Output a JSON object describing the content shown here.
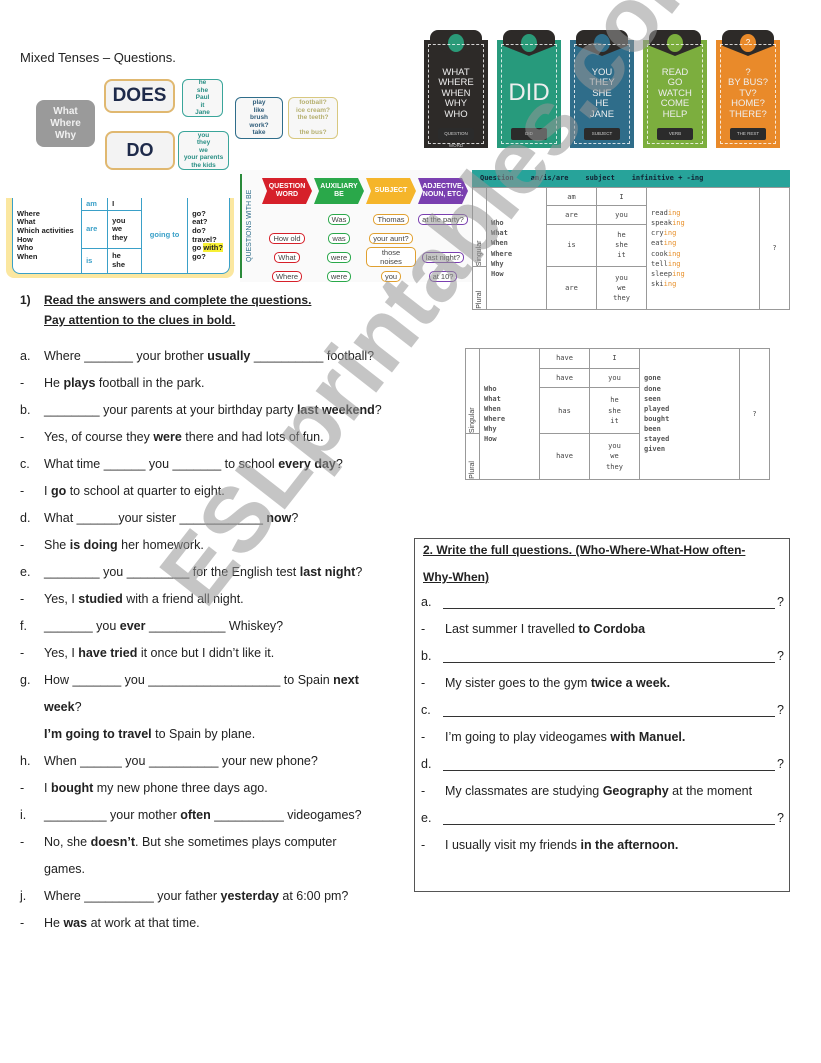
{
  "title": "Mixed Tenses – Questions.",
  "diagram_do": {
    "qwords": "What\nWhere\nWhy",
    "does": "DOES",
    "does_subjects": [
      "he",
      "she",
      "Paul",
      "it",
      "Jane"
    ],
    "do": "DO",
    "do_subjects": [
      "you",
      "they",
      "we",
      "your parents",
      "the kids"
    ],
    "verbs": [
      "play",
      "like",
      "brush",
      "work?",
      "take"
    ],
    "objects": [
      "football?",
      "ice cream?",
      "the teeth?",
      "",
      "the bus?"
    ]
  },
  "cards": [
    {
      "lines": [
        "WHAT",
        "WHERE",
        "WHEN",
        "WHY",
        "WHO"
      ],
      "label": "QUESTION WORD",
      "icon": "puzzle-icon",
      "color": "#2d2a28",
      "dot": "#2a9a78"
    },
    {
      "lines": [
        "DID"
      ],
      "label": "DID",
      "icon": "circle-icon",
      "color": "#279a7c",
      "dot": "#2a9a78"
    },
    {
      "lines": [
        "YOU",
        "THEY",
        "SHE",
        "HE",
        "JANE"
      ],
      "label": "SUBJECT",
      "icon": "person-icon",
      "color": "#2f6d8a",
      "dot": "#2f6d8a"
    },
    {
      "lines": [
        "READ",
        "GO",
        "WATCH",
        "COME",
        "HELP"
      ],
      "label": "VERB",
      "icon": "rocket-icon",
      "color": "#7cae3e",
      "dot": "#7cae3e"
    },
    {
      "lines": [
        "?",
        "BY BUS?",
        "TV?",
        "HOME?",
        "THERE?"
      ],
      "label": "THE REST",
      "icon": "question-icon",
      "color": "#e98a2a",
      "dot": "#e98a2a"
    }
  ],
  "going_to": {
    "qwords": [
      "Where",
      "What",
      "Which activities",
      "How",
      "Who",
      "When"
    ],
    "be": [
      "am",
      "are",
      "is"
    ],
    "subjects": [
      "I",
      "you\nwe\nthey",
      "he\nshe"
    ],
    "middle": "going to",
    "verbs_before": [
      "go?",
      "eat?",
      "do?",
      "travel?",
      "go "
    ],
    "highlight": "with?",
    "verb_last": "go?"
  },
  "be_questions": {
    "side": "QUESTIONS WITH BE",
    "headers": [
      "QUESTION\nWORD",
      "AUXILIARY\nBE",
      "SUBJECT",
      "ADJECTIVE,\nNOUN, ETC."
    ],
    "header_colors": [
      "#d6202a",
      "#2aa84a",
      "#f5b52a",
      "#7a3fb0"
    ],
    "rows": [
      [
        "",
        "Was",
        "Thomas",
        "at the party?"
      ],
      [
        "How old",
        "was",
        "your aunt?",
        ""
      ],
      [
        "What",
        "were",
        "those noises",
        "last night?"
      ],
      [
        "Where",
        "were",
        "you",
        "at 10?"
      ]
    ]
  },
  "present_continuous": {
    "header": "Question    am/is/are    subject    infinitive + -ing",
    "singular": "Singular",
    "plural": "Plural",
    "qwords": "Who\nWhat\nWhen\nWhere\nWhy\nHow",
    "aux": [
      "am",
      "are",
      "is",
      "are"
    ],
    "subjects": [
      "I",
      "you",
      "he\nshe\nit",
      "you\nwe\nthey"
    ],
    "verbs": [
      [
        "read",
        "ing"
      ],
      [
        "speak",
        "ing"
      ],
      [
        "cry",
        "ing"
      ],
      [
        "eat",
        "ing"
      ],
      [
        "cook",
        "ing"
      ],
      [
        "tell",
        "ing"
      ],
      [
        "sleep",
        "ing"
      ],
      [
        "ski",
        "ing"
      ]
    ],
    "end": "?"
  },
  "present_perfect": {
    "singular": "Singular",
    "plural": "Plural",
    "qwords": "Who\nWhat\nWhen\nWhere\nWhy\nHow",
    "aux": [
      "have",
      "have",
      "has",
      "have"
    ],
    "subjects": [
      "I",
      "you",
      "he\nshe\nit",
      "you\nwe\nthey"
    ],
    "participles": "gone\ndone\nseen\nplayed\nbought\nbeen\nstayed\ngiven",
    "end": "?"
  },
  "exercise1": {
    "number": "1)",
    "instruction1": "Read the answers and complete the questions.",
    "instruction2": "Pay attention to the clues in bold.",
    "lines": [
      {
        "label": "a.",
        "parts": [
          {
            "t": "Where _______ your brother "
          },
          {
            "t": "usually",
            "b": true
          },
          {
            "t": " __________ football?"
          }
        ]
      },
      {
        "label": "-",
        "parts": [
          {
            "t": "He "
          },
          {
            "t": "plays",
            "b": true
          },
          {
            "t": " football in the park."
          }
        ]
      },
      {
        "label": "b.",
        "parts": [
          {
            "t": "________ your parents at your birthday party "
          },
          {
            "t": "last weekend",
            "b": true
          },
          {
            "t": "?"
          }
        ]
      },
      {
        "label": "-",
        "parts": [
          {
            "t": "Yes, of course they "
          },
          {
            "t": "were",
            "b": true
          },
          {
            "t": " there and had lots of fun."
          }
        ]
      },
      {
        "label": "c.",
        "parts": [
          {
            "t": "What time ______ you _______ to school "
          },
          {
            "t": "every day",
            "b": true
          },
          {
            "t": "?"
          }
        ]
      },
      {
        "label": "-",
        "parts": [
          {
            "t": "I "
          },
          {
            "t": "go",
            "b": true
          },
          {
            "t": " to school at quarter to eight."
          }
        ]
      },
      {
        "label": "d.",
        "parts": [
          {
            "t": "What ______your sister ____________ "
          },
          {
            "t": "now",
            "b": true
          },
          {
            "t": "?"
          }
        ]
      },
      {
        "label": "-",
        "parts": [
          {
            "t": "She "
          },
          {
            "t": "is doing",
            "b": true
          },
          {
            "t": " her homework."
          }
        ]
      },
      {
        "label": "e.",
        "parts": [
          {
            "t": "________ you _________ for the English test "
          },
          {
            "t": "last night",
            "b": true
          },
          {
            "t": "?"
          }
        ]
      },
      {
        "label": "-",
        "parts": [
          {
            "t": "Yes, I "
          },
          {
            "t": "studied",
            "b": true
          },
          {
            "t": " with a friend all night."
          }
        ]
      },
      {
        "label": "f.",
        "parts": [
          {
            "t": "_______ you "
          },
          {
            "t": "ever",
            "b": true
          },
          {
            "t": " ___________ Whiskey?"
          }
        ]
      },
      {
        "label": "-",
        "parts": [
          {
            "t": "Yes, I "
          },
          {
            "t": "have tried",
            "b": true
          },
          {
            "t": " it once but I didn’t like it."
          }
        ]
      },
      {
        "label": "g.",
        "parts": [
          {
            "t": "How _______ you ___________________ to Spain "
          },
          {
            "t": "next",
            "b": true
          }
        ]
      },
      {
        "label": "",
        "parts": [
          {
            "t": "week",
            "b": true
          },
          {
            "t": "?"
          }
        ]
      },
      {
        "label": "",
        "parts": [
          {
            "t": "I’m going to travel",
            "b": true
          },
          {
            "t": " to Spain by plane."
          }
        ]
      },
      {
        "label": "h.",
        "parts": [
          {
            "t": "When ______ you __________ your new phone?"
          }
        ]
      },
      {
        "label": "-",
        "parts": [
          {
            "t": "I "
          },
          {
            "t": "bought",
            "b": true
          },
          {
            "t": " my new phone three days ago."
          }
        ]
      },
      {
        "label": "i.",
        "parts": [
          {
            "t": "_________ your mother "
          },
          {
            "t": "often",
            "b": true
          },
          {
            "t": " __________ videogames?"
          }
        ]
      },
      {
        "label": "-",
        "parts": [
          {
            "t": "No, she "
          },
          {
            "t": "doesn’t",
            "b": true
          },
          {
            "t": ".  But she sometimes plays computer"
          }
        ]
      },
      {
        "label": "",
        "parts": [
          {
            "t": "games."
          }
        ]
      },
      {
        "label": "j.",
        "parts": [
          {
            "t": "Where __________ your father "
          },
          {
            "t": "yesterday",
            "b": true
          },
          {
            "t": " at 6:00 pm?"
          }
        ]
      },
      {
        "label": "-",
        "parts": [
          {
            "t": "He "
          },
          {
            "t": "was",
            "b": true
          },
          {
            "t": " at work at that time."
          }
        ]
      }
    ]
  },
  "exercise2": {
    "instruction1": "2. Write the full questions. (Who-Where-What-How often-",
    "instruction2": "Why-When)",
    "blank_line": "?",
    "items": [
      {
        "label": "a.",
        "answer": [
          {
            "t": "Last summer I travelled "
          },
          {
            "t": "to Cordoba",
            "b": true
          }
        ]
      },
      {
        "label": "b.",
        "answer": [
          {
            "t": "My sister goes to the gym "
          },
          {
            "t": "twice a week.",
            "b": true
          }
        ]
      },
      {
        "label": "c.",
        "answer": [
          {
            "t": "I’m going to play videogames "
          },
          {
            "t": "with Manuel.",
            "b": true
          }
        ]
      },
      {
        "label": "d.",
        "answer": [
          {
            "t": "My classmates are studying "
          },
          {
            "t": "Geography",
            "b": true
          },
          {
            "t": " at the moment"
          }
        ]
      },
      {
        "label": "e.",
        "answer": [
          {
            "t": "I usually visit my friends "
          },
          {
            "t": "in the afternoon.",
            "b": true
          }
        ]
      }
    ]
  },
  "watermark": "ESLprintables.com"
}
